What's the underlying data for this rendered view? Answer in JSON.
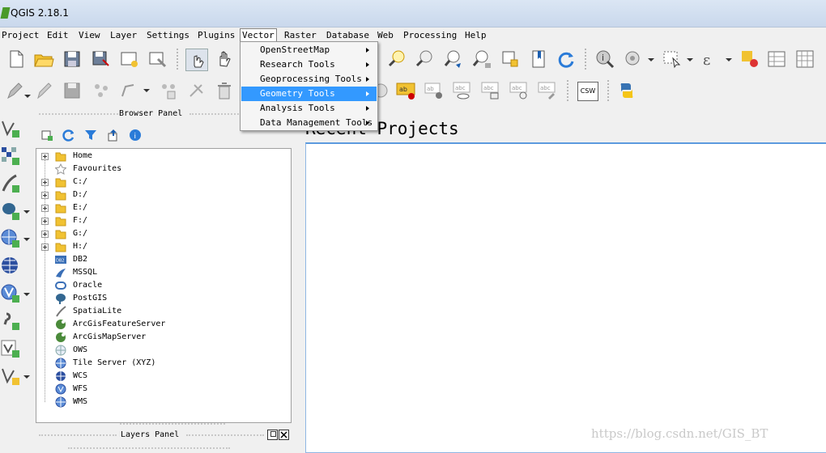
{
  "window": {
    "title": "QGIS 2.18.1"
  },
  "menubar": {
    "items": [
      {
        "label": "Project"
      },
      {
        "label": "Edit"
      },
      {
        "label": "View"
      },
      {
        "label": "Layer"
      },
      {
        "label": "Settings"
      },
      {
        "label": "Plugins"
      },
      {
        "label": "Vector"
      },
      {
        "label": "Raster"
      },
      {
        "label": "Database"
      },
      {
        "label": "Web"
      },
      {
        "label": "Processing"
      },
      {
        "label": "Help"
      }
    ],
    "open_menu": "Vector"
  },
  "vector_menu": {
    "items": [
      {
        "label": "OpenStreetMap"
      },
      {
        "label": "Research Tools"
      },
      {
        "label": "Geoprocessing Tools"
      },
      {
        "label": "Geometry Tools"
      },
      {
        "label": "Analysis Tools"
      },
      {
        "label": "Data Management Tools"
      }
    ],
    "highlighted": "Geometry Tools"
  },
  "toolbar2": {
    "csw_label": "CSW"
  },
  "browser_panel": {
    "title": "Browser Panel",
    "items": [
      {
        "label": "Home",
        "icon": "folder-icon",
        "expandable": true
      },
      {
        "label": "Favourites",
        "icon": "star-icon",
        "expandable": false
      },
      {
        "label": "C:/",
        "icon": "folder-icon",
        "expandable": true
      },
      {
        "label": "D:/",
        "icon": "folder-icon",
        "expandable": true
      },
      {
        "label": "E:/",
        "icon": "folder-icon",
        "expandable": true
      },
      {
        "label": "F:/",
        "icon": "folder-icon",
        "expandable": true
      },
      {
        "label": "G:/",
        "icon": "folder-icon",
        "expandable": true
      },
      {
        "label": "H:/",
        "icon": "folder-icon",
        "expandable": true
      },
      {
        "label": "DB2",
        "icon": "db2-icon",
        "expandable": false
      },
      {
        "label": "MSSQL",
        "icon": "mssql-icon",
        "expandable": false
      },
      {
        "label": "Oracle",
        "icon": "oracle-icon",
        "expandable": false
      },
      {
        "label": "PostGIS",
        "icon": "postgis-icon",
        "expandable": false
      },
      {
        "label": "SpatiaLite",
        "icon": "spatialite-icon",
        "expandable": false
      },
      {
        "label": "ArcGisFeatureServer",
        "icon": "arcgis-feature-icon",
        "expandable": false
      },
      {
        "label": "ArcGisMapServer",
        "icon": "arcgis-map-icon",
        "expandable": false
      },
      {
        "label": "OWS",
        "icon": "ows-icon",
        "expandable": false
      },
      {
        "label": "Tile Server (XYZ)",
        "icon": "globe-icon",
        "expandable": false
      },
      {
        "label": "WCS",
        "icon": "globe-icon",
        "expandable": false
      },
      {
        "label": "WFS",
        "icon": "globe-icon",
        "expandable": false
      },
      {
        "label": "WMS",
        "icon": "globe-icon",
        "expandable": false
      }
    ]
  },
  "layers_panel": {
    "title": "Layers Panel"
  },
  "recent_projects": {
    "title": "Recent Projects"
  },
  "watermark": "https://blog.csdn.net/GIS_BT",
  "colors": {
    "highlight": "#3399ff",
    "accent_border": "#5c9ade"
  }
}
